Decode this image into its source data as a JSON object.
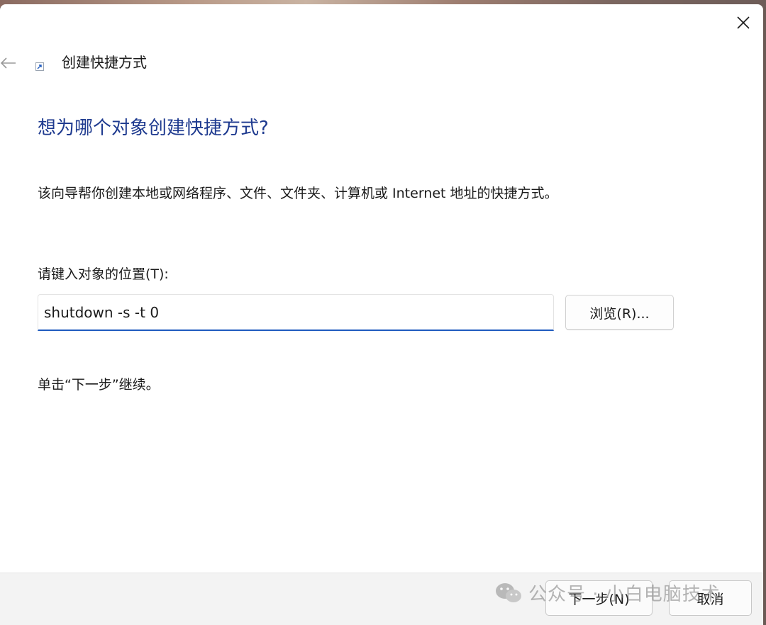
{
  "window": {
    "title": "创建快捷方式",
    "close_icon": "close-icon",
    "back_icon": "back-arrow-icon",
    "title_icon": "shortcut-icon"
  },
  "main": {
    "heading": "想为哪个对象创建快捷方式?",
    "description": "该向导帮你创建本地或网络程序、文件、文件夹、计算机或 Internet 地址的快捷方式。",
    "location_label": "请键入对象的位置(T):",
    "location_value": "shutdown -s -t 0",
    "browse_label": "浏览(R)...",
    "continue_hint": "单击“下一步”继续。"
  },
  "footer": {
    "next_label": "下一步(N)",
    "cancel_label": "取消"
  },
  "watermark": {
    "text": "公众号 · 小白电脑技术",
    "icon": "wechat-icon"
  },
  "colors": {
    "heading": "#1e3a8f",
    "input_focus": "#1f5bbf",
    "footer_bg": "#f3f3f3"
  }
}
